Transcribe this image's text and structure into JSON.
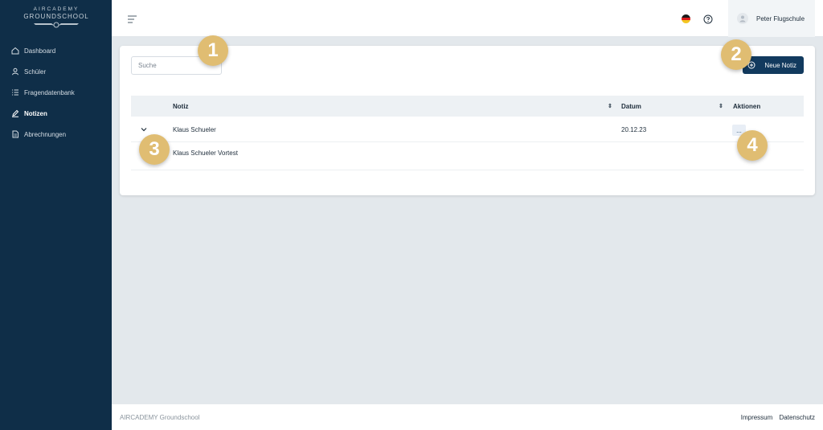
{
  "app": {
    "logo_line1": "AIRCADEMY",
    "logo_line2": "GROUNDSCHOOL"
  },
  "sidebar": {
    "items": [
      {
        "label": "Dashboard",
        "icon": "home-icon",
        "active": false
      },
      {
        "label": "Schüler",
        "icon": "user-icon",
        "active": false
      },
      {
        "label": "Fragendatenbank",
        "icon": "list-icon",
        "active": false
      },
      {
        "label": "Notizen",
        "icon": "pencil-icon",
        "active": true
      },
      {
        "label": "Abrechnungen",
        "icon": "document-icon",
        "active": false
      }
    ]
  },
  "header": {
    "language": "de",
    "user_name": "Peter Flugschule"
  },
  "main": {
    "search_placeholder": "Suche",
    "new_button_label": "Neue Notiz",
    "table": {
      "columns": [
        "Notiz",
        "Datum",
        "Aktionen"
      ],
      "rows": [
        {
          "notiz": "Klaus Schueler",
          "datum": "20.12.23",
          "actions": "...",
          "expanded": true,
          "detail": "Klaus Schueler Vortest"
        }
      ]
    }
  },
  "callouts": [
    "1",
    "2",
    "3",
    "4"
  ],
  "footer": {
    "brand": "AIRCADEMY Groundschool",
    "links": [
      "Impressum",
      "Datenschutz"
    ]
  },
  "colors": {
    "sidebar": "#0f2e48",
    "accent": "#123a5e",
    "callout": "#e0bd72",
    "background": "#e3e8ec"
  }
}
